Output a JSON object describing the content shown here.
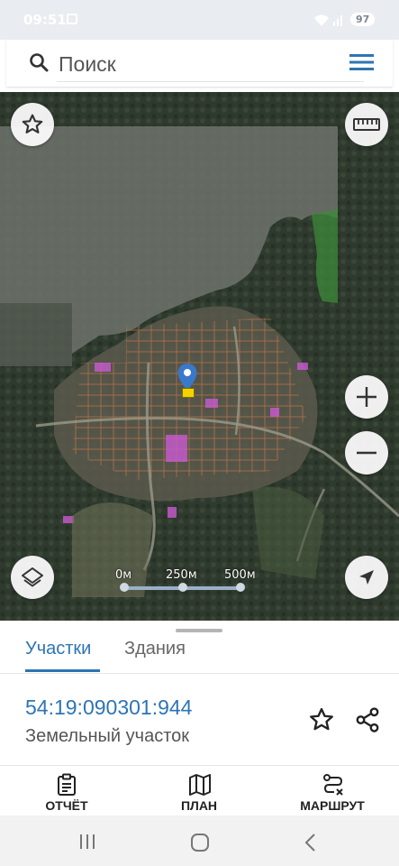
{
  "status": {
    "time": "09:51",
    "battery": "97"
  },
  "search": {
    "placeholder": "Поиск"
  },
  "map": {
    "scale_labels": [
      "0м",
      "250м",
      "500м"
    ]
  },
  "tabs": [
    {
      "label": "Участки",
      "active": true
    },
    {
      "label": "Здания",
      "active": false
    }
  ],
  "parcel": {
    "cadastral_number": "54:19:090301:944",
    "type": "Земельный участок"
  },
  "actions": [
    {
      "label": "ОТЧЁТ",
      "icon": "report-icon"
    },
    {
      "label": "ПЛАН",
      "icon": "map-plan-icon"
    },
    {
      "label": "МАРШРУТ",
      "icon": "route-icon"
    }
  ],
  "colors": {
    "accent": "#2d74b5",
    "parcel_border": "#d07a4a",
    "highlight": "#c95ad1",
    "marker": "#3a78c9"
  }
}
